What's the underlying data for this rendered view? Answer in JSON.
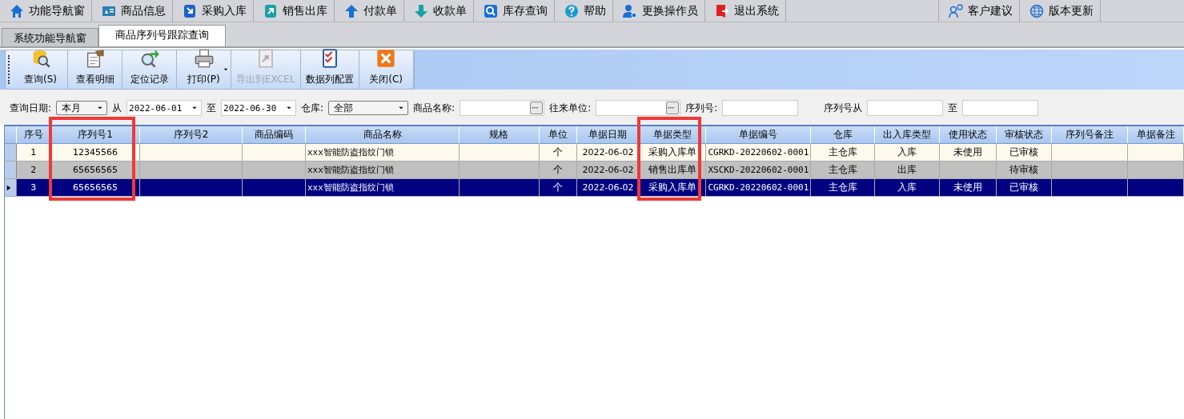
{
  "menu": {
    "items": [
      {
        "label": "功能导航窗"
      },
      {
        "label": "商品信息"
      },
      {
        "label": "采购入库"
      },
      {
        "label": "销售出库"
      },
      {
        "label": "付款单"
      },
      {
        "label": "收款单"
      },
      {
        "label": "库存查询"
      },
      {
        "label": "帮助"
      },
      {
        "label": "更换操作员"
      },
      {
        "label": "退出系统"
      }
    ],
    "right_items": [
      {
        "label": "客户建议"
      },
      {
        "label": "版本更新"
      }
    ]
  },
  "tabs": [
    {
      "label": "系统功能导航窗",
      "selected": false
    },
    {
      "label": "商品序列号跟踪查询",
      "selected": true
    }
  ],
  "toolbar": [
    {
      "label": "查询(S)",
      "disabled": false,
      "dropdown": false
    },
    {
      "label": "查看明细",
      "disabled": false,
      "dropdown": false
    },
    {
      "label": "定位记录",
      "disabled": false,
      "dropdown": false
    },
    {
      "label": "打印(P)",
      "disabled": false,
      "dropdown": true
    },
    {
      "label": "导出到EXCEL",
      "disabled": true,
      "dropdown": false
    },
    {
      "label": "数据列配置",
      "disabled": false,
      "dropdown": false
    },
    {
      "label": "关闭(C)",
      "disabled": false,
      "dropdown": false
    }
  ],
  "filters": [
    {
      "kind": "select",
      "label": "查询日期:",
      "value": "本月"
    },
    {
      "kind": "date",
      "label": "从",
      "value": "2022-06-01"
    },
    {
      "kind": "date",
      "label": "至",
      "value": "2022-06-30"
    },
    {
      "kind": "select",
      "label": "仓库:",
      "value": "全部"
    },
    {
      "kind": "lookup",
      "label": "商品名称:"
    },
    {
      "kind": "lookup",
      "label": "往来单位:"
    },
    {
      "kind": "text",
      "label": "序列号:"
    },
    {
      "kind": "text",
      "label": "序列号从"
    },
    {
      "kind": "text",
      "label": "至"
    }
  ],
  "table": {
    "columns": [
      {
        "label": "序号",
        "highlighted": false
      },
      {
        "label": "序列号1",
        "highlighted": true
      },
      {
        "label": "序列号2",
        "highlighted": false
      },
      {
        "label": "商品编码",
        "highlighted": false
      },
      {
        "label": "商品名称",
        "highlighted": false
      },
      {
        "label": "规格",
        "highlighted": false
      },
      {
        "label": "单位",
        "highlighted": false
      },
      {
        "label": "单据日期",
        "highlighted": false
      },
      {
        "label": "单据类型",
        "highlighted": true
      },
      {
        "label": "单据编号",
        "highlighted": false
      },
      {
        "label": "仓库",
        "highlighted": false
      },
      {
        "label": "出入库类型",
        "highlighted": false
      },
      {
        "label": "使用状态",
        "highlighted": false
      },
      {
        "label": "审核状态",
        "highlighted": false
      },
      {
        "label": "序列号备注",
        "highlighted": false
      },
      {
        "label": "单据备注",
        "highlighted": false
      }
    ],
    "rows": [
      {
        "selected": false,
        "cells": [
          "1",
          "12345566",
          "",
          "",
          "xxx智能防盗指纹门锁",
          "",
          "个",
          "2022-06-02",
          "采购入库单",
          "CGRKD-20220602-0001",
          "主仓库",
          "入库",
          "未使用",
          "已审核",
          "",
          ""
        ]
      },
      {
        "selected": false,
        "cells": [
          "2",
          "65656565",
          "",
          "",
          "xxx智能防盗指纹门锁",
          "",
          "个",
          "2022-06-02",
          "销售出库单",
          "XSCKD-20220602-0001",
          "主仓库",
          "出库",
          "",
          "待审核",
          "",
          ""
        ]
      },
      {
        "selected": true,
        "cells": [
          "3",
          "65656565",
          "",
          "",
          "xxx智能防盗指纹门锁",
          "",
          "个",
          "2022-06-02",
          "采购入库单",
          "CGRKD-20220602-0001",
          "主仓库",
          "入库",
          "未使用",
          "已审核",
          "",
          ""
        ]
      }
    ]
  }
}
